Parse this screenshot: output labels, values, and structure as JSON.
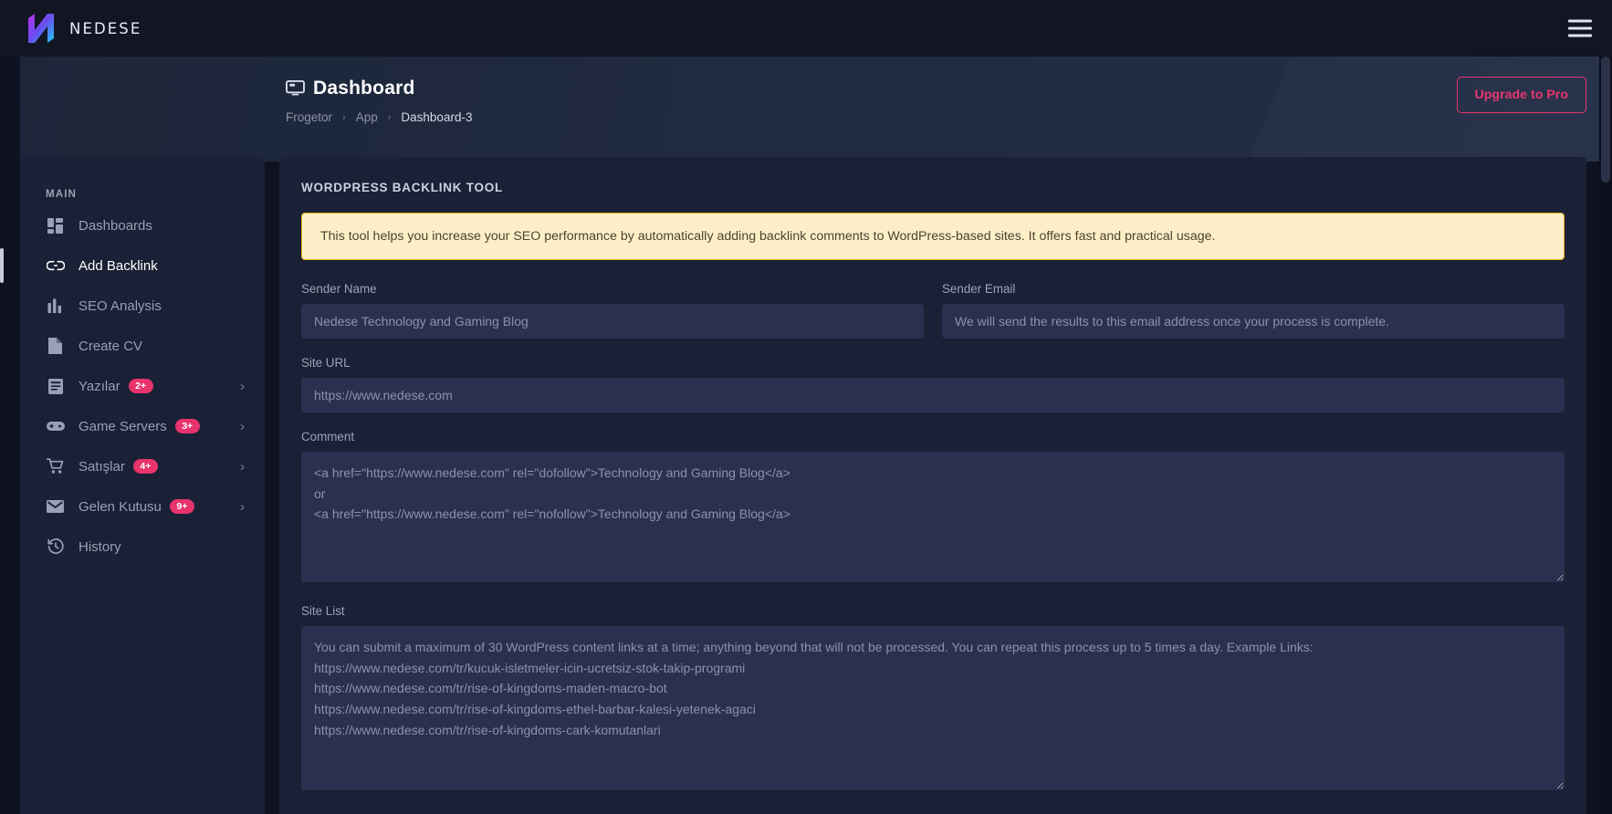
{
  "topbar": {
    "brand_name": "NEDESE",
    "logo_icon": "nedese-n-logo",
    "menu_icon": "hamburger-icon"
  },
  "header": {
    "title": "Dashboard",
    "title_icon": "desktop-monitor-icon",
    "breadcrumb": [
      {
        "label": "Frogetor",
        "current": false
      },
      {
        "label": "App",
        "current": false
      },
      {
        "label": "Dashboard-3",
        "current": true
      }
    ],
    "separator": "›",
    "upgrade_label": "Upgrade to Pro",
    "accent_color": "#e8336d"
  },
  "sidebar": {
    "section_label": "MAIN",
    "items": [
      {
        "label": "Dashboards",
        "icon": "grid-dashboard-icon",
        "badge": null,
        "chevron": false,
        "active": false
      },
      {
        "label": "Add Backlink",
        "icon": "link-chain-icon",
        "badge": null,
        "chevron": false,
        "active": true
      },
      {
        "label": "SEO Analysis",
        "icon": "bar-chart-icon",
        "badge": null,
        "chevron": false,
        "active": false
      },
      {
        "label": "Create CV",
        "icon": "document-icon",
        "badge": null,
        "chevron": false,
        "active": false
      },
      {
        "label": "Yazılar",
        "icon": "article-icon",
        "badge": "2+",
        "chevron": true,
        "active": false
      },
      {
        "label": "Game Servers",
        "icon": "gamepad-icon",
        "badge": "3+",
        "chevron": true,
        "active": false
      },
      {
        "label": "Satışlar",
        "icon": "shopping-cart-icon",
        "badge": "4+",
        "chevron": true,
        "active": false
      },
      {
        "label": "Gelen Kutusu",
        "icon": "envelope-icon",
        "badge": "9+",
        "chevron": true,
        "active": false
      },
      {
        "label": "History",
        "icon": "history-clock-icon",
        "badge": null,
        "chevron": false,
        "active": false
      }
    ],
    "badge_color": "#e8336d"
  },
  "main": {
    "card_title": "WORDPRESS BACKLINK TOOL",
    "alert": {
      "text": "This tool helps you increase your SEO performance by automatically adding backlink comments to WordPress-based sites. It offers fast and practical usage.",
      "background": "#fcefc7",
      "border_color": "#e8b21f"
    },
    "fields": {
      "sender_name": {
        "label": "Sender Name",
        "placeholder": "Nedese Technology and Gaming Blog",
        "value": ""
      },
      "sender_email": {
        "label": "Sender Email",
        "placeholder": "We will send the results to this email address once your process is complete.",
        "value": ""
      },
      "site_url": {
        "label": "Site URL",
        "placeholder": "https://www.nedese.com",
        "value": ""
      },
      "comment": {
        "label": "Comment",
        "placeholder": "<a href=\"https://www.nedese.com\" rel=\"dofollow\">Technology and Gaming Blog</a>\nor\n<a href=\"https://www.nedese.com\" rel=\"nofollow\">Technology and Gaming Blog</a>",
        "value": ""
      },
      "site_list": {
        "label": "Site List",
        "placeholder": "You can submit a maximum of 30 WordPress content links at a time; anything beyond that will not be processed. You can repeat this process up to 5 times a day. Example Links:\nhttps://www.nedese.com/tr/kucuk-isletmeler-icin-ucretsiz-stok-takip-programi\nhttps://www.nedese.com/tr/rise-of-kingdoms-maden-macro-bot\nhttps://www.nedese.com/tr/rise-of-kingdoms-ethel-barbar-kalesi-yetenek-agaci\nhttps://www.nedese.com/tr/rise-of-kingdoms-cark-komutanlari",
        "value": ""
      }
    }
  }
}
